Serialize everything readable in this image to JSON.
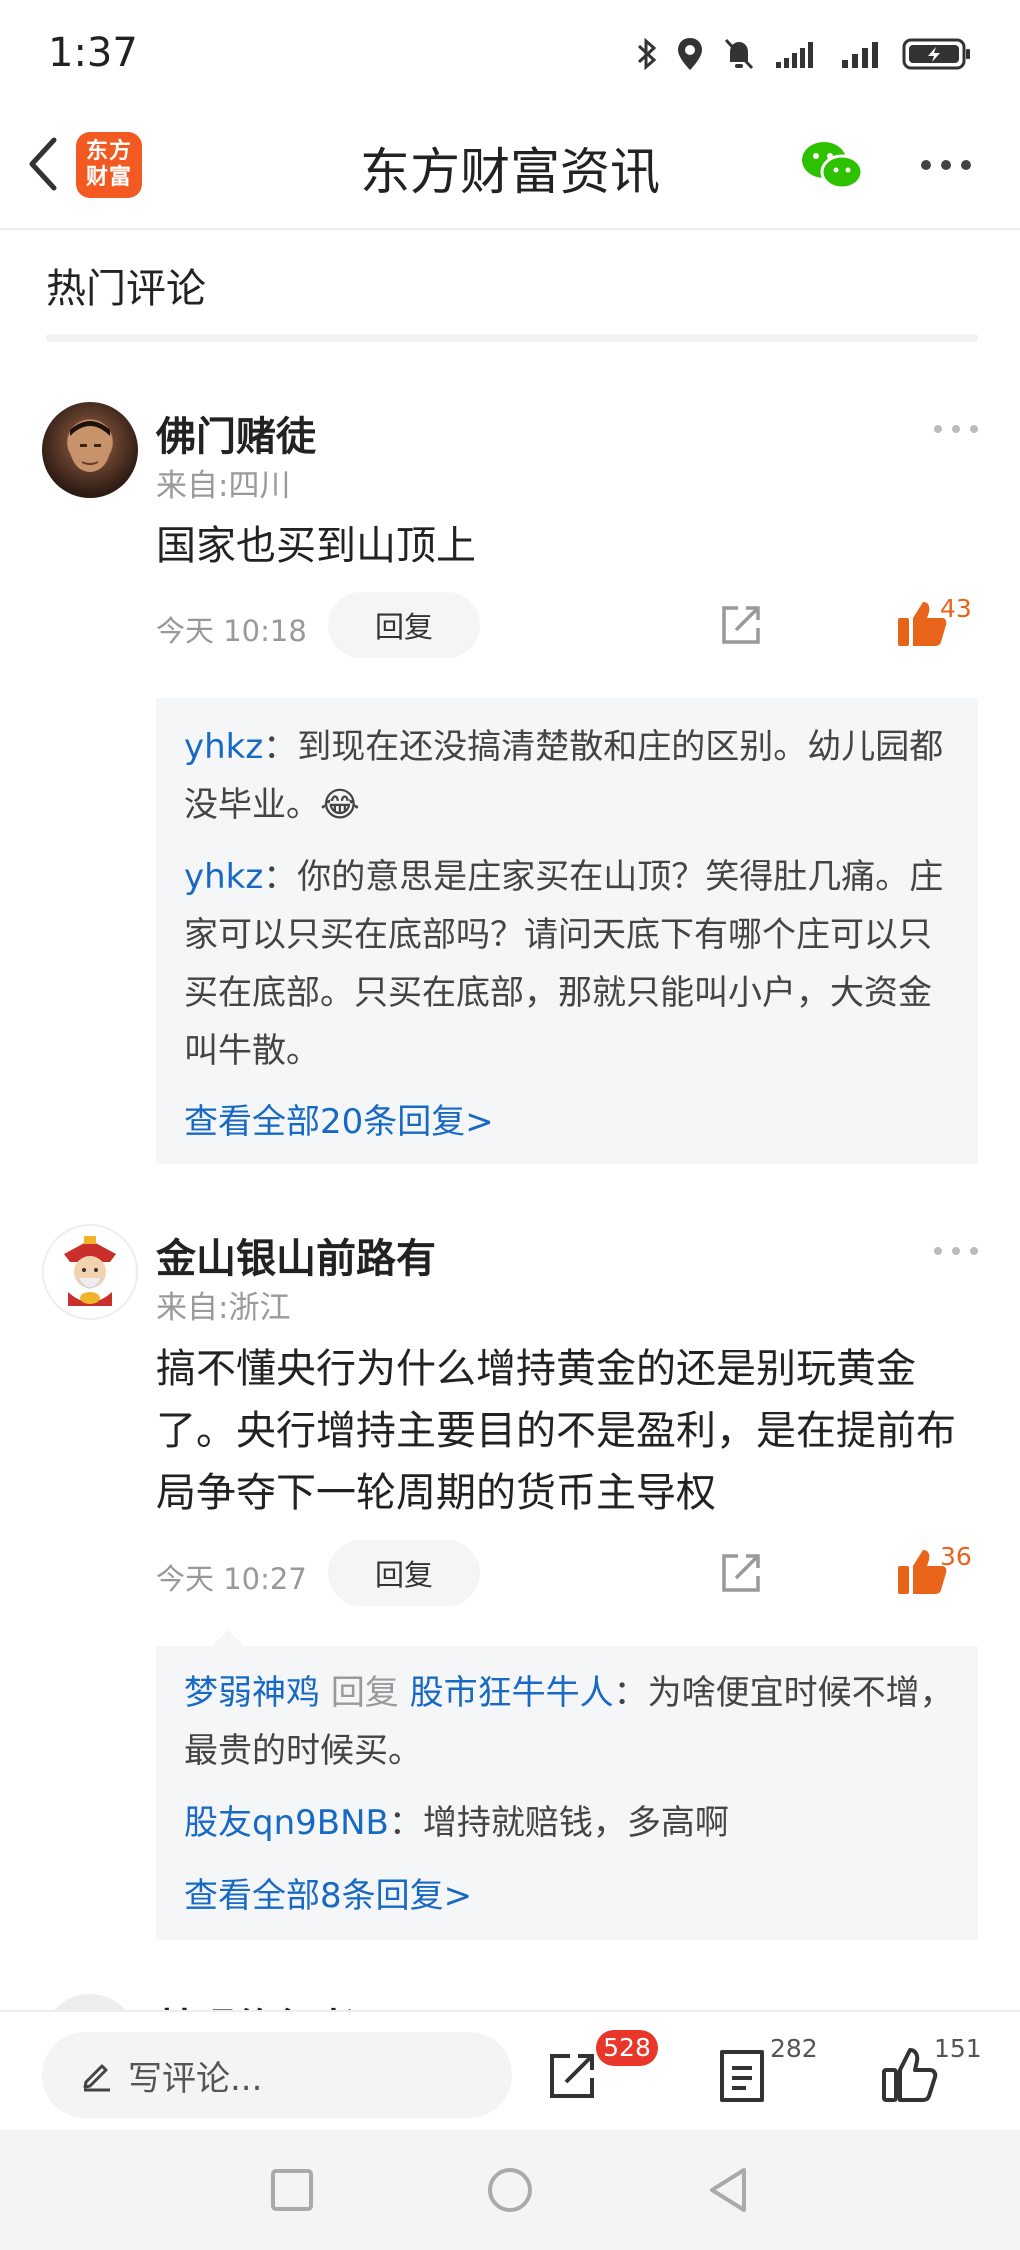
{
  "status_bar": {
    "time": "1:37"
  },
  "header": {
    "title": "东方财富资讯",
    "logo_line1": "东方",
    "logo_line2": "财富"
  },
  "section": {
    "title": "热门评论"
  },
  "comments": [
    {
      "username": "佛门赌徒",
      "location": "来自:四川",
      "text": "国家也买到山顶上",
      "time": "今天 10:18",
      "reply_label": "回复",
      "likes": "43",
      "replies": [
        {
          "author": "yhkz",
          "sep": "：",
          "text": "到现在还没搞清楚散和庄的区别。幼儿园都没毕业。",
          "emoji": "😂"
        },
        {
          "author": "yhkz",
          "sep": "：",
          "text": "你的意思是庄家买在山顶？笑得肚几痛。庄家可以只买在底部吗？请问天底下有哪个庄可以只买在底部。只买在底部，那就只能叫小户，大资金叫牛散。"
        }
      ],
      "view_all": "查看全部20条回复>"
    },
    {
      "username": "金山银山前路有",
      "location": "来自:浙江",
      "text": "搞不懂央行为什么增持黄金的还是别玩黄金了。央行增持主要目的不是盈利，是在提前布局争夺下一轮周期的货币主导权",
      "time": "今天 10:27",
      "reply_label": "回复",
      "likes": "36",
      "replies": [
        {
          "author": "梦弱神鸡",
          "mid": "回复",
          "target": "股市狂牛牛人",
          "sep": "：",
          "text": "为啥便宜时候不增，最贵的时候买。"
        },
        {
          "author": "股友qn9BNB",
          "sep": "：",
          "text": "增持就赔钱，多高啊"
        }
      ],
      "view_all": "查看全部8条回复>"
    }
  ],
  "partial_next": {
    "username": "林眼修行者"
  },
  "bottom_bar": {
    "compose_placeholder": "写评论...",
    "share_count": "528",
    "comment_count": "282",
    "like_count": "151"
  },
  "colors": {
    "brand": "#f25a22",
    "link": "#1769c4",
    "like": "#e8641b",
    "badge": "#e8362b",
    "wechat": "#2dc100"
  },
  "icons": [
    "back-icon",
    "wechat-icon",
    "more-icon",
    "share-icon",
    "thumb-up-icon",
    "pencil-icon",
    "comment-list-icon",
    "square-nav-icon",
    "circle-nav-icon",
    "triangle-nav-icon"
  ]
}
